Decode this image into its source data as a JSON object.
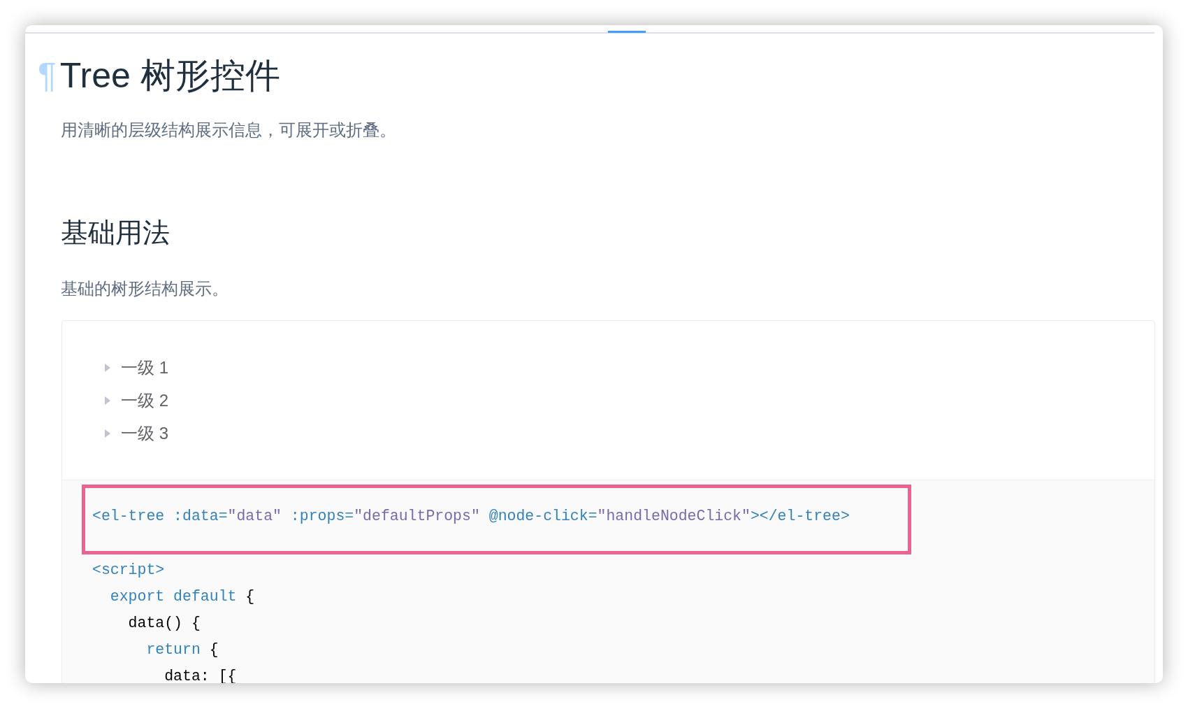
{
  "title": {
    "anchor": "¶",
    "text": "Tree 树形控件"
  },
  "description": "用清晰的层级结构展示信息，可展开或折叠。",
  "section": {
    "heading": "基础用法",
    "description": "基础的树形结构展示。",
    "tree": [
      {
        "label": "一级 1",
        "expanded": false
      },
      {
        "label": "一级 2",
        "expanded": false
      },
      {
        "label": "一级 3",
        "expanded": false
      }
    ],
    "code_lines": [
      {
        "highlighted": true,
        "tokens": [
          {
            "kind": "tag",
            "text": "<el-tree :data="
          },
          {
            "kind": "string",
            "text": "\"data\""
          },
          {
            "kind": "tag",
            "text": " :props="
          },
          {
            "kind": "string",
            "text": "\"defaultProps\""
          },
          {
            "kind": "tag",
            "text": " @node-click="
          },
          {
            "kind": "string",
            "text": "\"handleNodeClick\""
          },
          {
            "kind": "tag",
            "text": "></el-tree>"
          }
        ]
      },
      {
        "highlighted": false,
        "tokens": [
          {
            "kind": "tag",
            "text": "<script>"
          }
        ]
      },
      {
        "highlighted": false,
        "tokens": [
          {
            "kind": "keyword",
            "text": "  export default"
          },
          {
            "kind": "plain",
            "text": " {"
          }
        ]
      },
      {
        "highlighted": false,
        "tokens": [
          {
            "kind": "plain",
            "text": "    data() {"
          }
        ]
      },
      {
        "highlighted": false,
        "tokens": [
          {
            "kind": "keyword",
            "text": "      return"
          },
          {
            "kind": "plain",
            "text": " {"
          }
        ]
      },
      {
        "highlighted": false,
        "tokens": [
          {
            "kind": "plain",
            "text": "        data: [{"
          }
        ]
      }
    ]
  }
}
